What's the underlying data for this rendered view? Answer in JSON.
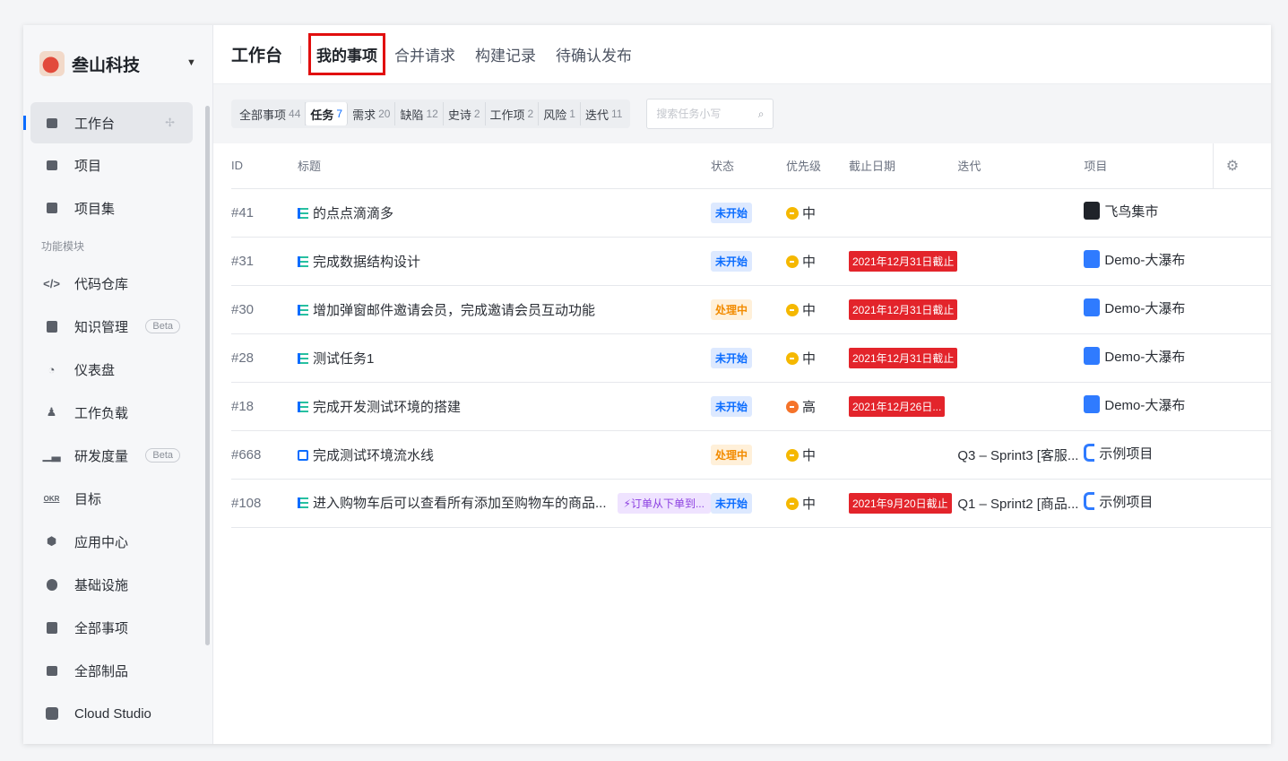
{
  "sidebar": {
    "org_name": "叁山科技",
    "items_top": [
      {
        "label": "工作台",
        "icon": "workbench-icon"
      },
      {
        "label": "项目",
        "icon": "folder-icon"
      },
      {
        "label": "项目集",
        "icon": "project-set-icon"
      }
    ],
    "section_label": "功能模块",
    "modules": [
      {
        "label": "代码仓库",
        "icon": "code-icon",
        "badge": ""
      },
      {
        "label": "知识管理",
        "icon": "knowledge-icon",
        "badge": "Beta"
      },
      {
        "label": "仪表盘",
        "icon": "dashboard-icon",
        "badge": ""
      },
      {
        "label": "工作负载",
        "icon": "workload-icon",
        "badge": ""
      },
      {
        "label": "研发度量",
        "icon": "metrics-icon",
        "badge": "Beta"
      },
      {
        "label": "目标",
        "icon": "okr-icon",
        "badge": ""
      },
      {
        "label": "应用中心",
        "icon": "app-center-icon",
        "badge": ""
      },
      {
        "label": "基础设施",
        "icon": "infrastructure-icon",
        "badge": ""
      },
      {
        "label": "全部事项",
        "icon": "all-items-icon",
        "badge": ""
      },
      {
        "label": "全部制品",
        "icon": "artifacts-icon",
        "badge": ""
      },
      {
        "label": "Cloud Studio",
        "icon": "cloud-studio-icon",
        "badge": ""
      }
    ]
  },
  "topbar": {
    "title": "工作台",
    "tabs": [
      "我的事项",
      "合并请求",
      "构建记录",
      "待确认发布"
    ]
  },
  "filters": {
    "chips": [
      {
        "label": "全部事项",
        "count": "44"
      },
      {
        "label": "任务",
        "count": "7"
      },
      {
        "label": "需求",
        "count": "20"
      },
      {
        "label": "缺陷",
        "count": "12"
      },
      {
        "label": "史诗",
        "count": "2"
      },
      {
        "label": "工作项",
        "count": "2"
      },
      {
        "label": "风险",
        "count": "1"
      },
      {
        "label": "迭代",
        "count": "11"
      }
    ],
    "search_placeholder": "搜索任务小写"
  },
  "table": {
    "headers": [
      "ID",
      "标题",
      "状态",
      "优先级",
      "截止日期",
      "迭代",
      "项目"
    ],
    "rows": [
      {
        "id": "#41",
        "title": "的点点滴滴多",
        "tag": "",
        "status": "未开始",
        "priority": "中",
        "due": "",
        "iteration": "",
        "project": "飞鸟集市"
      },
      {
        "id": "#31",
        "title": "完成数据结构设计",
        "tag": "",
        "status": "未开始",
        "priority": "中",
        "due": "2021年12月31日截止",
        "iteration": "",
        "project": "Demo-大瀑布"
      },
      {
        "id": "#30",
        "title": "增加弹窗邮件邀请会员，完成邀请会员互动功能",
        "tag": "",
        "status": "处理中",
        "priority": "中",
        "due": "2021年12月31日截止",
        "iteration": "",
        "project": "Demo-大瀑布"
      },
      {
        "id": "#28",
        "title": "测试任务1",
        "tag": "",
        "status": "未开始",
        "priority": "中",
        "due": "2021年12月31日截止",
        "iteration": "",
        "project": "Demo-大瀑布"
      },
      {
        "id": "#18",
        "title": "完成开发测试环境的搭建",
        "tag": "",
        "status": "未开始",
        "priority": "高",
        "due": "2021年12月26日...",
        "iteration": "",
        "project": "Demo-大瀑布"
      },
      {
        "id": "#668",
        "title": "完成测试环境流水线",
        "tag": "",
        "status": "处理中",
        "priority": "中",
        "due": "",
        "iteration": "Q3 – Sprint3 [客服...",
        "project": "示例项目"
      },
      {
        "id": "#108",
        "title": "进入购物车后可以查看所有添加至购物车的商品...",
        "tag": "⚡订单从下单到...",
        "status": "未开始",
        "priority": "中",
        "due": "2021年9月20日截止",
        "iteration": "Q1 – Sprint2 [商品...",
        "project": "示例项目"
      }
    ]
  },
  "colors": {
    "accent": "#0a6cff",
    "highlight_box": "#e10e0e",
    "due_red": "#e3242b",
    "priority_mid": "#f5b800",
    "priority_high": "#f5732a",
    "status_blue": "#0a6cff",
    "status_orange": "#f28b00"
  }
}
